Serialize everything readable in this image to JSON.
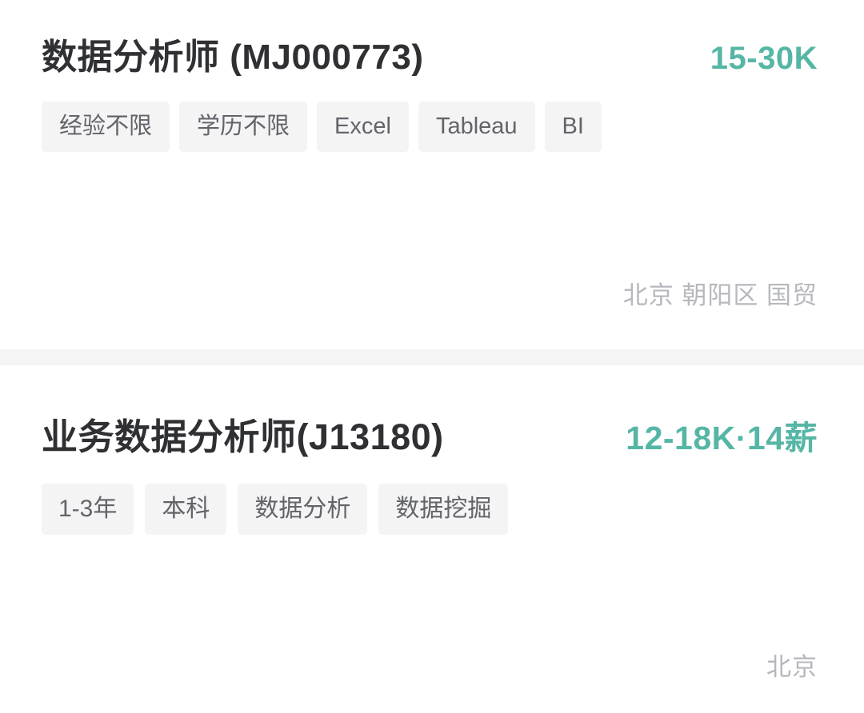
{
  "list": {
    "name": "job-search-results",
    "divider_color": "#f5f5f6",
    "accent_color": "#56b6a5",
    "jobs": [
      {
        "title": "数据分析师 (MJ000773)",
        "salary": "15-30K",
        "tags": [
          "经验不限",
          "学历不限",
          "Excel",
          "Tableau",
          "BI"
        ],
        "location": "北京 朝阳区 国贸"
      },
      {
        "title": "业务数据分析师(J13180)",
        "salary": "12-18K·14薪",
        "tags": [
          "1-3年",
          "本科",
          "数据分析",
          "数据挖掘"
        ],
        "location": "北京"
      }
    ]
  }
}
